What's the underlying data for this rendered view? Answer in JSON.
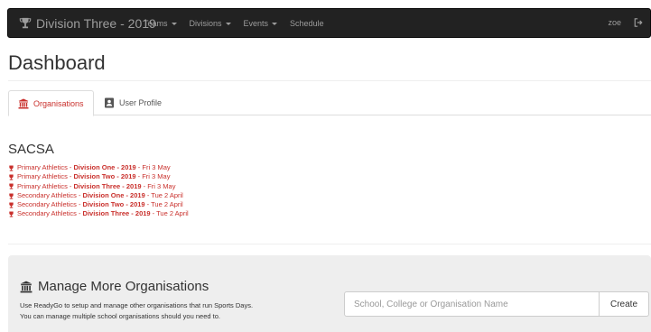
{
  "navbar": {
    "brand_label": "Division Three - 2019",
    "brand_icon": "trophy-icon",
    "items": [
      {
        "label": "Teams",
        "has_caret": true
      },
      {
        "label": "Divisions",
        "has_caret": true
      },
      {
        "label": "Events",
        "has_caret": true
      },
      {
        "label": "Schedule",
        "has_caret": false
      }
    ],
    "user": "zoe",
    "logout_icon": "sign-out-icon"
  },
  "page": {
    "title": "Dashboard"
  },
  "tabs": [
    {
      "label": "Organisations",
      "icon": "bank-icon",
      "active": true
    },
    {
      "label": "User Profile",
      "icon": "id-card-icon",
      "active": false
    }
  ],
  "organisation": {
    "name": "SACSA",
    "events": [
      {
        "prefix": "Primary Athletics - ",
        "division": "Division One - 2019",
        "date": " - Fri 3 May"
      },
      {
        "prefix": "Primary Athletics - ",
        "division": "Division Two - 2019",
        "date": " - Fri 3 May"
      },
      {
        "prefix": "Primary Athletics - ",
        "division": "Division Three - 2019",
        "date": " - Fri 3 May"
      },
      {
        "prefix": "Secondary Athletics - ",
        "division": "Division One - 2019",
        "date": " - Tue 2 April"
      },
      {
        "prefix": "Secondary Athletics - ",
        "division": "Division Two - 2019",
        "date": " - Tue 2 April"
      },
      {
        "prefix": "Secondary Athletics - ",
        "division": "Division Three - 2019",
        "date": " - Tue 2 April"
      }
    ]
  },
  "manage": {
    "title": "Manage More Organisations",
    "desc_line1": "Use ReadyGo to setup and manage other organisations that run Sports Days.",
    "desc_line2": "You can manage multiple school organisations should you need to.",
    "input_placeholder": "School, College or Organisation Name",
    "input_value": "",
    "create_label": "Create"
  },
  "colors": {
    "navbar_bg": "#222222",
    "nav_text": "#9d9d9d",
    "accent_red": "#c9302c",
    "jumbotron_bg": "#eeeeee"
  }
}
